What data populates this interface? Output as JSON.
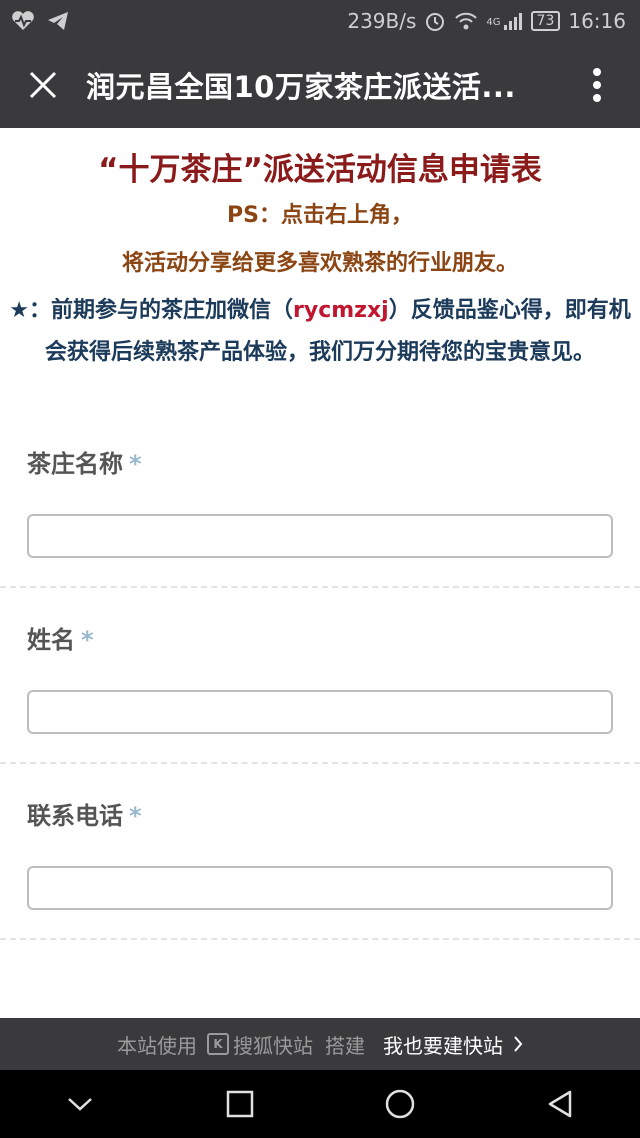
{
  "status_bar": {
    "speed": "239B/s",
    "network": "4G",
    "battery": "73",
    "time": "16:16"
  },
  "title_bar": {
    "title": "润元昌全国10万家茶庄派送活..."
  },
  "header": {
    "form_title": "“十万茶庄”派送活动信息申请表",
    "ps_line": "PS：点击右上角，",
    "share_line": "将活动分享给更多喜欢熟茶的行业朋友。",
    "notice_prefix": "★：前期参与的茶庄加微信（",
    "notice_wechat": "rycmzxj",
    "notice_suffix": "）反馈品鉴心得，即有机会获得后续熟茶产品体验，我们万分期待您的宝贵意见。"
  },
  "form": {
    "fields": [
      {
        "label": "茶庄名称",
        "required_mark": "*",
        "value": ""
      },
      {
        "label": "姓名",
        "required_mark": "*",
        "value": ""
      },
      {
        "label": "联系电话",
        "required_mark": "*",
        "value": ""
      }
    ]
  },
  "footer": {
    "prefix": "本站使用",
    "brand": "搜狐快站",
    "suffix": "搭建",
    "link": "我也要建快站",
    "brand_mark": "K"
  },
  "icons": {
    "close": "close-icon",
    "more": "more-vertical-icon",
    "back": "nav-back-icon",
    "home": "nav-home-icon",
    "recent": "nav-recent-icon",
    "collapse": "nav-collapse-icon"
  },
  "colors": {
    "bar_bg": "#3a3a3c",
    "title_red": "#8b1a1a",
    "ps_brown": "#8b4513",
    "notice_blue": "#1c3a5a",
    "wechat_red": "#c0162f",
    "required_blue": "#9ab9cc"
  }
}
